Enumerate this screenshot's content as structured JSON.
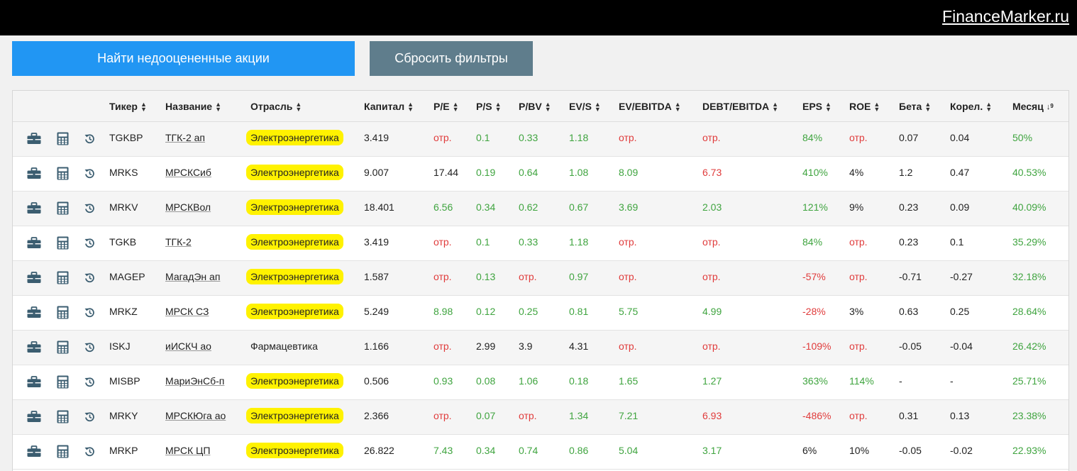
{
  "brand": "FinanceMarker.ru",
  "buttons": {
    "find": "Найти недооцененные акции",
    "reset": "Сбросить фильтры"
  },
  "columns": [
    "Тикер",
    "Название",
    "Отрасль",
    "Капитал",
    "P/E",
    "P/S",
    "P/BV",
    "EV/S",
    "EV/EBITDA",
    "DEBT/EBITDA",
    "EPS",
    "ROE",
    "Бета",
    "Корел.",
    "Месяц"
  ],
  "rows": [
    {
      "ticker": "TGKBP",
      "name": "ТГК-2 ап",
      "sector": "Электроэнергетика",
      "highlight": true,
      "cap": "3.419",
      "pe": "отр.",
      "ps": "0.1",
      "pbv": "0.33",
      "evs": "1.18",
      "evebitda": "отр.",
      "debt": "отр.",
      "eps": "84%",
      "roe": "отр.",
      "beta": "0.07",
      "corr": "0.04",
      "month": "50%"
    },
    {
      "ticker": "MRKS",
      "name": "МРСКСиб",
      "sector": "Электроэнергетика",
      "highlight": true,
      "cap": "9.007",
      "pe": "17.44",
      "ps": "0.19",
      "pbv": "0.64",
      "evs": "1.08",
      "evebitda": "8.09",
      "debt": "6.73",
      "eps": "410%",
      "roe": "4%",
      "beta": "1.2",
      "corr": "0.47",
      "month": "40.53%"
    },
    {
      "ticker": "MRKV",
      "name": "МРСКВол",
      "sector": "Электроэнергетика",
      "highlight": true,
      "cap": "18.401",
      "pe": "6.56",
      "ps": "0.34",
      "pbv": "0.62",
      "evs": "0.67",
      "evebitda": "3.69",
      "debt": "2.03",
      "eps": "121%",
      "roe": "9%",
      "beta": "0.23",
      "corr": "0.09",
      "month": "40.09%"
    },
    {
      "ticker": "TGKB",
      "name": "ТГК-2",
      "sector": "Электроэнергетика",
      "highlight": true,
      "cap": "3.419",
      "pe": "отр.",
      "ps": "0.1",
      "pbv": "0.33",
      "evs": "1.18",
      "evebitda": "отр.",
      "debt": "отр.",
      "eps": "84%",
      "roe": "отр.",
      "beta": "0.23",
      "corr": "0.1",
      "month": "35.29%"
    },
    {
      "ticker": "MAGEP",
      "name": "МагадЭн ап",
      "sector": "Электроэнергетика",
      "highlight": true,
      "cap": "1.587",
      "pe": "отр.",
      "ps": "0.13",
      "pbv": "отр.",
      "evs": "0.97",
      "evebitda": "отр.",
      "debt": "отр.",
      "eps": "-57%",
      "roe": "отр.",
      "beta": "-0.71",
      "corr": "-0.27",
      "month": "32.18%"
    },
    {
      "ticker": "MRKZ",
      "name": "МРСК СЗ",
      "sector": "Электроэнергетика",
      "highlight": true,
      "cap": "5.249",
      "pe": "8.98",
      "ps": "0.12",
      "pbv": "0.25",
      "evs": "0.81",
      "evebitda": "5.75",
      "debt": "4.99",
      "eps": "-28%",
      "roe": "3%",
      "beta": "0.63",
      "corr": "0.25",
      "month": "28.64%"
    },
    {
      "ticker": "ISKJ",
      "name": "иИСКЧ ао",
      "sector": "Фармацевтика",
      "highlight": false,
      "cap": "1.166",
      "pe": "отр.",
      "ps": "2.99",
      "pbv": "3.9",
      "evs": "4.31",
      "evebitda": "отр.",
      "debt": "отр.",
      "eps": "-109%",
      "roe": "отр.",
      "beta": "-0.05",
      "corr": "-0.04",
      "month": "26.42%"
    },
    {
      "ticker": "MISBP",
      "name": "МариЭнСб-п",
      "sector": "Электроэнергетика",
      "highlight": true,
      "cap": "0.506",
      "pe": "0.93",
      "ps": "0.08",
      "pbv": "1.06",
      "evs": "0.18",
      "evebitda": "1.65",
      "debt": "1.27",
      "eps": "363%",
      "roe": "114%",
      "beta": "-",
      "corr": "-",
      "month": "25.71%"
    },
    {
      "ticker": "MRKY",
      "name": "МРСКЮга ао",
      "sector": "Электроэнергетика",
      "highlight": true,
      "cap": "2.366",
      "pe": "отр.",
      "ps": "0.07",
      "pbv": "отр.",
      "evs": "1.34",
      "evebitda": "7.21",
      "debt": "6.93",
      "eps": "-486%",
      "roe": "отр.",
      "beta": "0.31",
      "corr": "0.13",
      "month": "23.38%"
    },
    {
      "ticker": "MRKP",
      "name": "МРСК ЦП",
      "sector": "Электроэнергетика",
      "highlight": true,
      "cap": "26.822",
      "pe": "7.43",
      "ps": "0.34",
      "pbv": "0.74",
      "evs": "0.86",
      "evebitda": "5.04",
      "debt": "3.17",
      "eps": "6%",
      "roe": "10%",
      "beta": "-0.05",
      "corr": "-0.02",
      "month": "22.93%"
    }
  ],
  "colors": {
    "positive": "#3fa43f",
    "negative": "#e03b3b",
    "neutral": "#222222",
    "highlight": "#fff200",
    "primary": "#2196f3",
    "reset": "#5f7d8c"
  },
  "row_icons": [
    "briefcase-icon",
    "calculator-icon",
    "history-icon"
  ]
}
